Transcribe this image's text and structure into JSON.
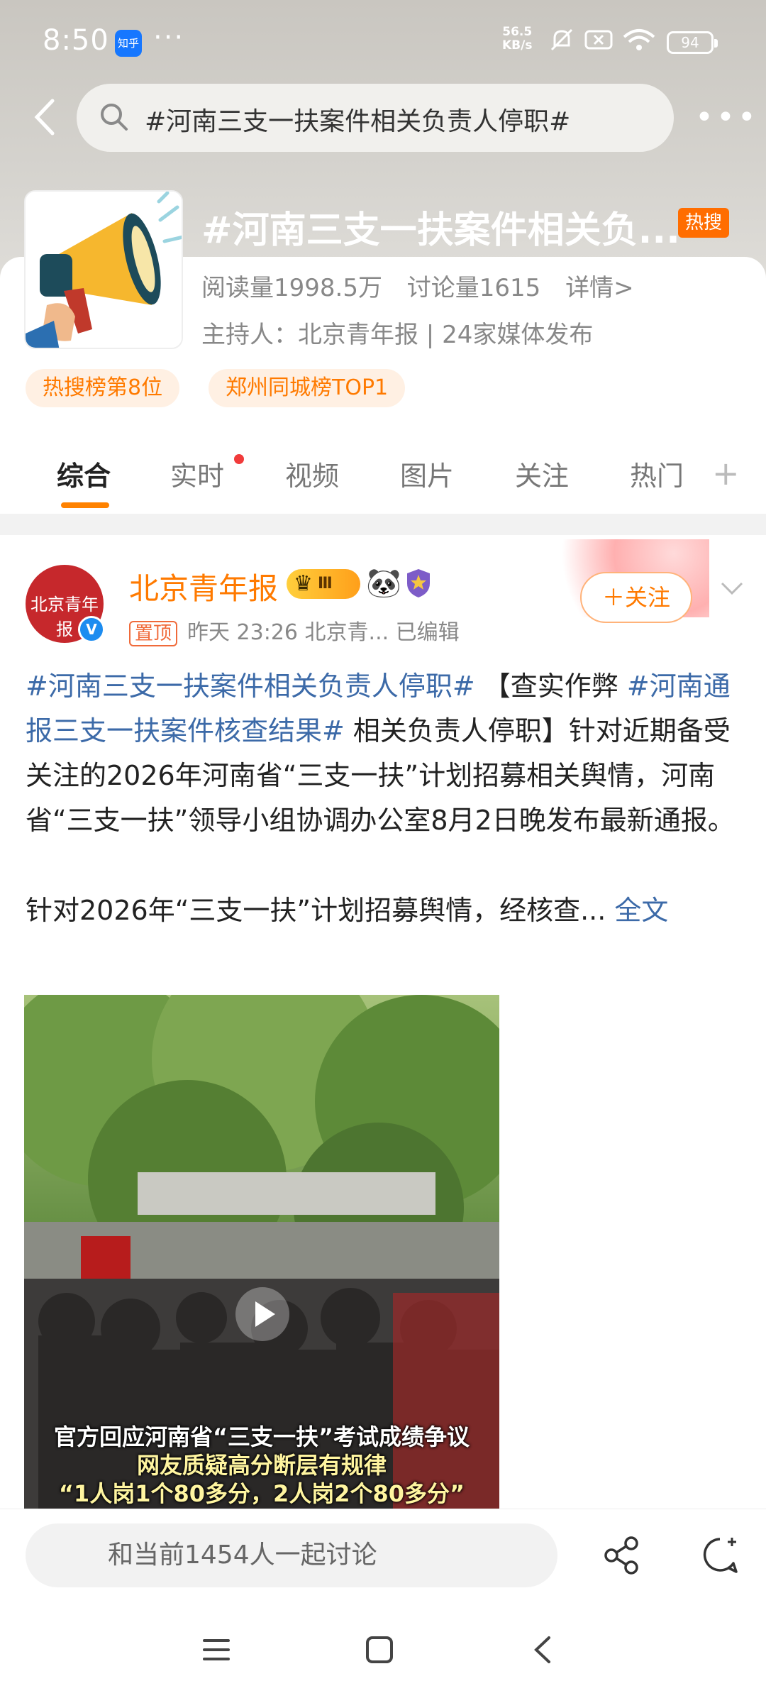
{
  "status_bar": {
    "time": "8:50",
    "app_badge": "知乎",
    "notif_dots": "···",
    "speed_value": "56.5",
    "speed_unit": "KB/s",
    "battery": "94"
  },
  "search": {
    "query": "#河南三支一扶案件相关负责人停职#"
  },
  "topic": {
    "title": "#河南三支一扶案件相关负...",
    "hot_badge": "热搜",
    "reads": "阅读量1998.5万",
    "discussions": "讨论量1615",
    "details": "详情>",
    "host": "主持人：北京青年报 | 24家媒体发布",
    "pills": [
      "热搜榜第8位",
      "郑州同城榜TOP1"
    ]
  },
  "tabs": {
    "items": [
      "综合",
      "实时",
      "视频",
      "图片",
      "关注",
      "热门"
    ],
    "active": "综合"
  },
  "post": {
    "author": "北京青年报",
    "avatar_text": "北京青年报",
    "level": "Ⅲ",
    "pinned": "置顶",
    "meta": "昨天 23:26   北京青...   已编辑",
    "follow": "＋关注",
    "tag1": "#河南三支一扶案件相关负责人停职#",
    "text1": " 【查实作弊 ",
    "tag2": "#河南通报三支一扶案件核查结果#",
    "text2": " 相关负责人停职】针对近期备受关注的2026年河南省“三支一扶”计划招募相关舆情，河南省“三支一扶”领导小组协调办公室8月2日晚发布最新通报。",
    "text3": "针对2026年“三支一扶”计划招募舆情，经核查...",
    "more": "全文",
    "video_caption_1": "官方回应河南省“三支一扶”考试成绩争议",
    "video_caption_2": "网友质疑高分断层有规律",
    "video_caption_3": "“1人岗1个80多分，2人岗2个80多分”"
  },
  "bottom": {
    "discuss_placeholder": "和当前1454人一起讨论"
  }
}
